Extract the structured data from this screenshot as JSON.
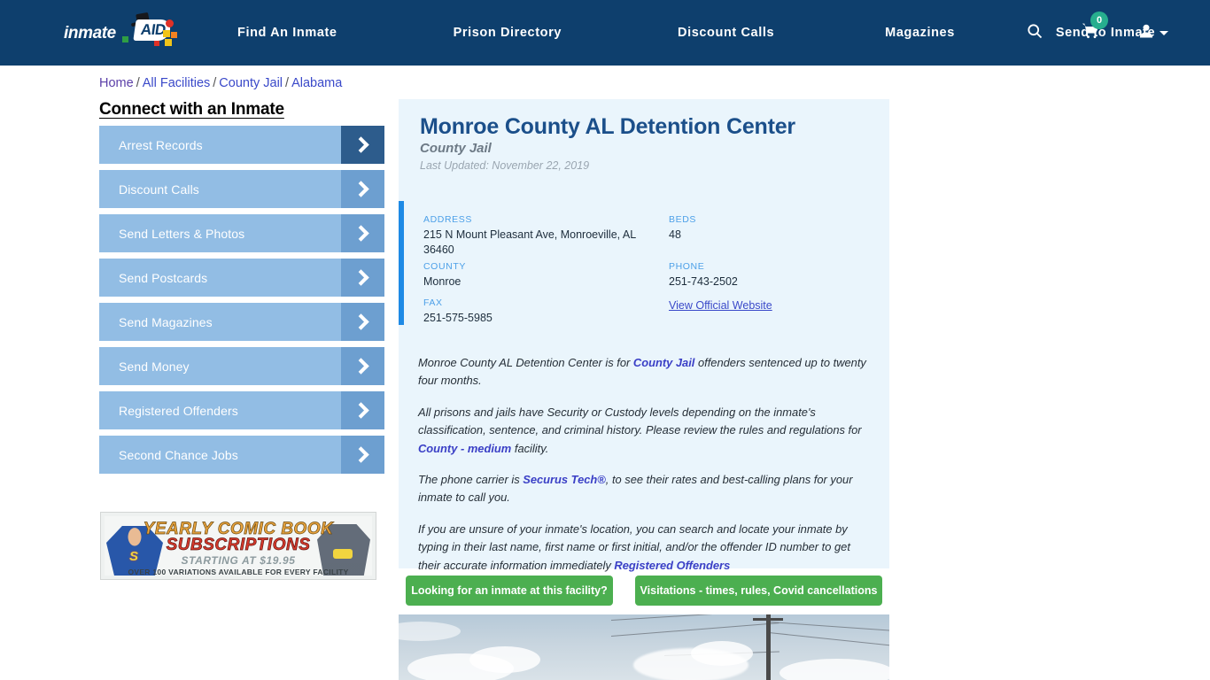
{
  "header": {
    "logo_text": "inmate",
    "logo_aid": "AID",
    "nav": [
      {
        "label": "Find An Inmate"
      },
      {
        "label": "Prison Directory"
      },
      {
        "label": "Discount Calls"
      },
      {
        "label": "Magazines"
      },
      {
        "label": "Send to Inmate"
      }
    ],
    "icons": {
      "search": "search-icon",
      "cart": "cart-icon",
      "cart_count": "0",
      "account": "user-icon"
    },
    "colors": {
      "bar": "#0e3f6d",
      "badge": "#27ae8e"
    }
  },
  "breadcrumb": {
    "items": [
      "Home",
      "All Facilities",
      "County Jail",
      "Alabama"
    ],
    "separator": "/"
  },
  "sidebar": {
    "title": "Connect with an Inmate",
    "items": [
      {
        "label": "Arrest Records"
      },
      {
        "label": "Discount Calls"
      },
      {
        "label": "Send Letters & Photos"
      },
      {
        "label": "Send Postcards"
      },
      {
        "label": "Send Magazines"
      },
      {
        "label": "Send Money"
      },
      {
        "label": "Registered Offenders"
      },
      {
        "label": "Second Chance Jobs"
      }
    ]
  },
  "ad": {
    "line1": "YEARLY COMIC BOOK",
    "line2": "SUBSCRIPTIONS",
    "line3": "STARTING AT $19.95",
    "line4": "OVER 100 VARIATIONS AVAILABLE FOR EVERY FACILITY"
  },
  "facility": {
    "name": "Monroe County AL Detention Center",
    "type": "County Jail",
    "last_updated": "Last Updated: November 22, 2019",
    "info": {
      "address_label": "ADDRESS",
      "address_value": "215 N Mount Pleasant Ave, Monroeville, AL 36460",
      "county_label": "COUNTY",
      "county_value": "Monroe",
      "fax_label": "FAX",
      "fax_value": "251-575-5985",
      "beds_label": "BEDS",
      "beds_value": "48",
      "phone_label": "PHONE",
      "phone_value": "251-743-2502",
      "website_label": "View Official Website"
    },
    "paragraphs": {
      "p1_a": "Monroe County AL Detention Center is for ",
      "p1_link": "County Jail",
      "p1_b": " offenders sentenced up to twenty four months.",
      "p2_a": "All prisons and jails have Security or Custody levels depending on the inmate's classification, sentence, and criminal history. Please review the rules and regulations for ",
      "p2_link": "County - medium",
      "p2_b": " facility.",
      "p3_a": "The phone carrier is ",
      "p3_link": "Securus Tech®",
      "p3_b": ", to see their rates and best-calling plans for your inmate to call you.",
      "p4_a": "If you are unsure of your inmate's location, you can search and locate your inmate by typing in their last name, first name or first initial, and/or the offender ID number to get their accurate information immediately ",
      "p4_link": "Registered Offenders"
    },
    "buttons": {
      "inmate_search": "Looking for an inmate at this facility?",
      "visitations": "Visitations - times, rules, Covid cancellations"
    }
  },
  "colors": {
    "card_bg": "#eaf5fc",
    "accent_bar": "#1e8ae5",
    "title": "#1b4f8a",
    "green_button": "#4caf50",
    "sidebar_button": "#92bde4",
    "sidebar_arrow": "#6d9fd0",
    "sidebar_arrow_active": "#2d5c8c"
  }
}
